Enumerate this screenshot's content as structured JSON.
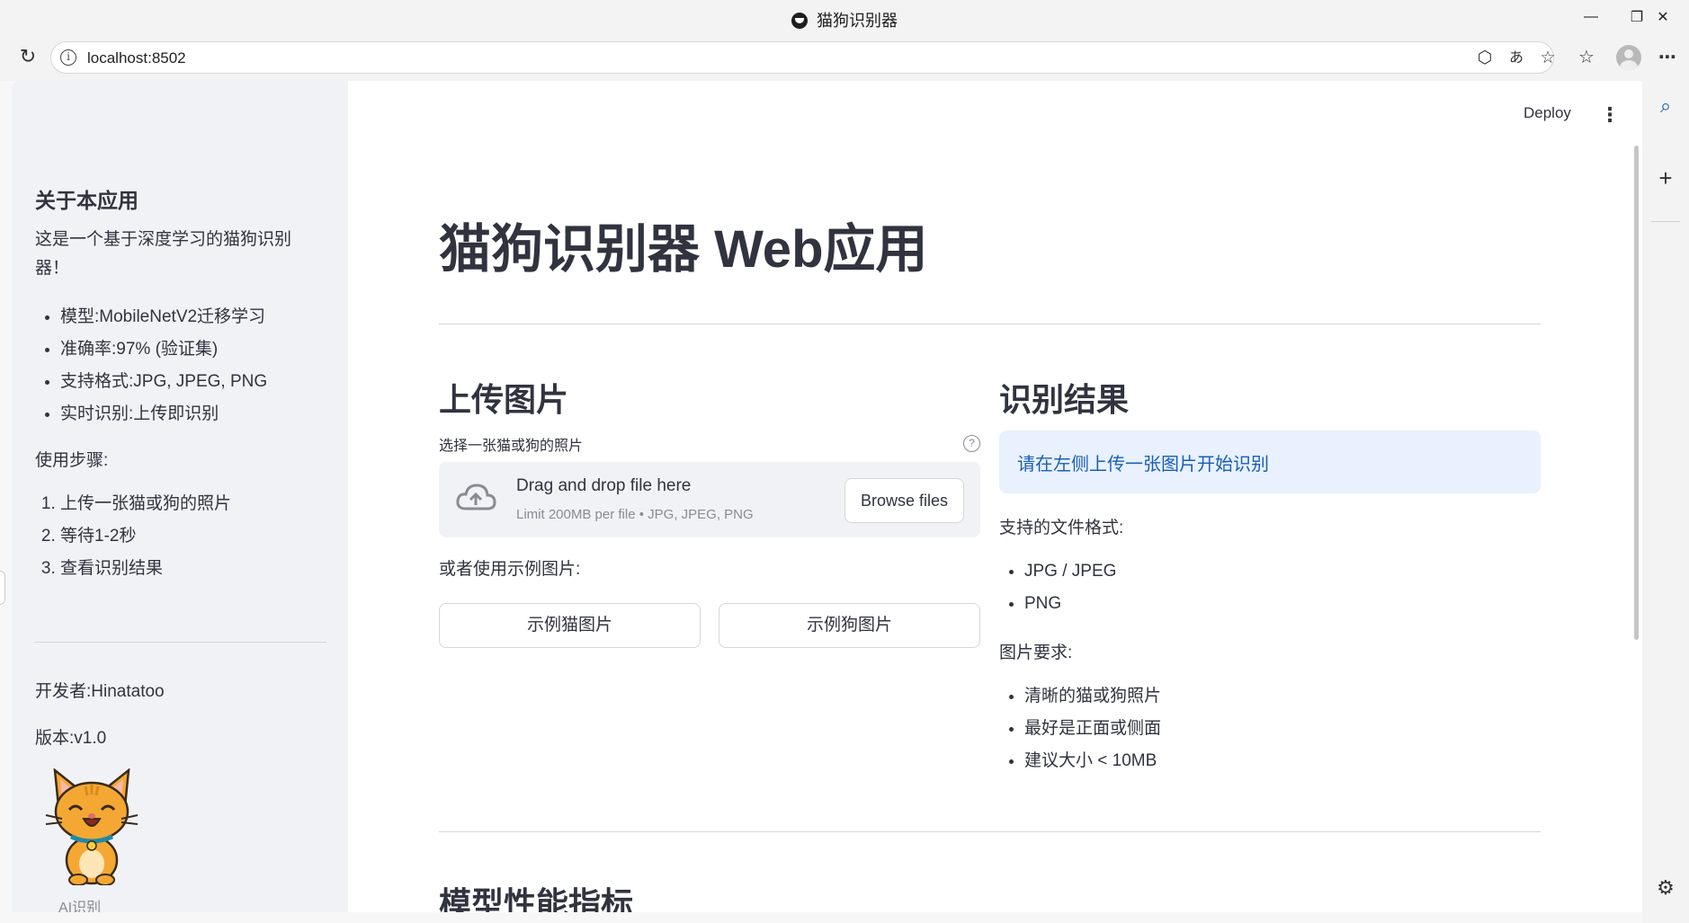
{
  "window": {
    "title": "猫狗识别器"
  },
  "browser": {
    "url": "localhost:8502"
  },
  "sidebar": {
    "about_title": "关于本应用",
    "intro_line1": "这是一个基于深度学习的猫狗识别",
    "intro_line2": "器！",
    "features": [
      "模型:MobileNetV2迁移学习",
      "准确率:97% (验证集)",
      "支持格式:JPG, JPEG, PNG",
      "实时识别:上传即识别"
    ],
    "steps_title": "使用步骤:",
    "steps": [
      "上传一张猫或狗的照片",
      "等待1-2秒",
      "查看识别结果"
    ],
    "developer": "开发者:Hinatatoo",
    "version": "版本:v1.0",
    "image_caption": "AI识别"
  },
  "header": {
    "deploy_label": "Deploy"
  },
  "main": {
    "title": "猫狗识别器 Web应用",
    "upload": {
      "heading": "上传图片",
      "label": "选择一张猫或狗的照片",
      "drop_text": "Drag and drop file here",
      "limit_text": "Limit 200MB per file • JPG, JPEG, PNG",
      "browse_label": "Browse files",
      "example_prompt": "或者使用示例图片:",
      "example_cat": "示例猫图片",
      "example_dog": "示例狗图片"
    },
    "result": {
      "heading": "识别结果",
      "info": "请在左侧上传一张图片开始识别",
      "formats_title": "支持的文件格式:",
      "formats": [
        "JPG / JPEG",
        "PNG"
      ],
      "requirements_title": "图片要求:",
      "requirements": [
        "清晰的猫或狗照片",
        "最好是正面或侧面",
        "建议大小 < 10MB"
      ]
    },
    "metrics_heading": "模型性能指标"
  },
  "colors": {
    "info_bg": "#e8f1fd",
    "info_text": "#1a5fb4",
    "sidebar_bg": "#f0f2f6"
  }
}
